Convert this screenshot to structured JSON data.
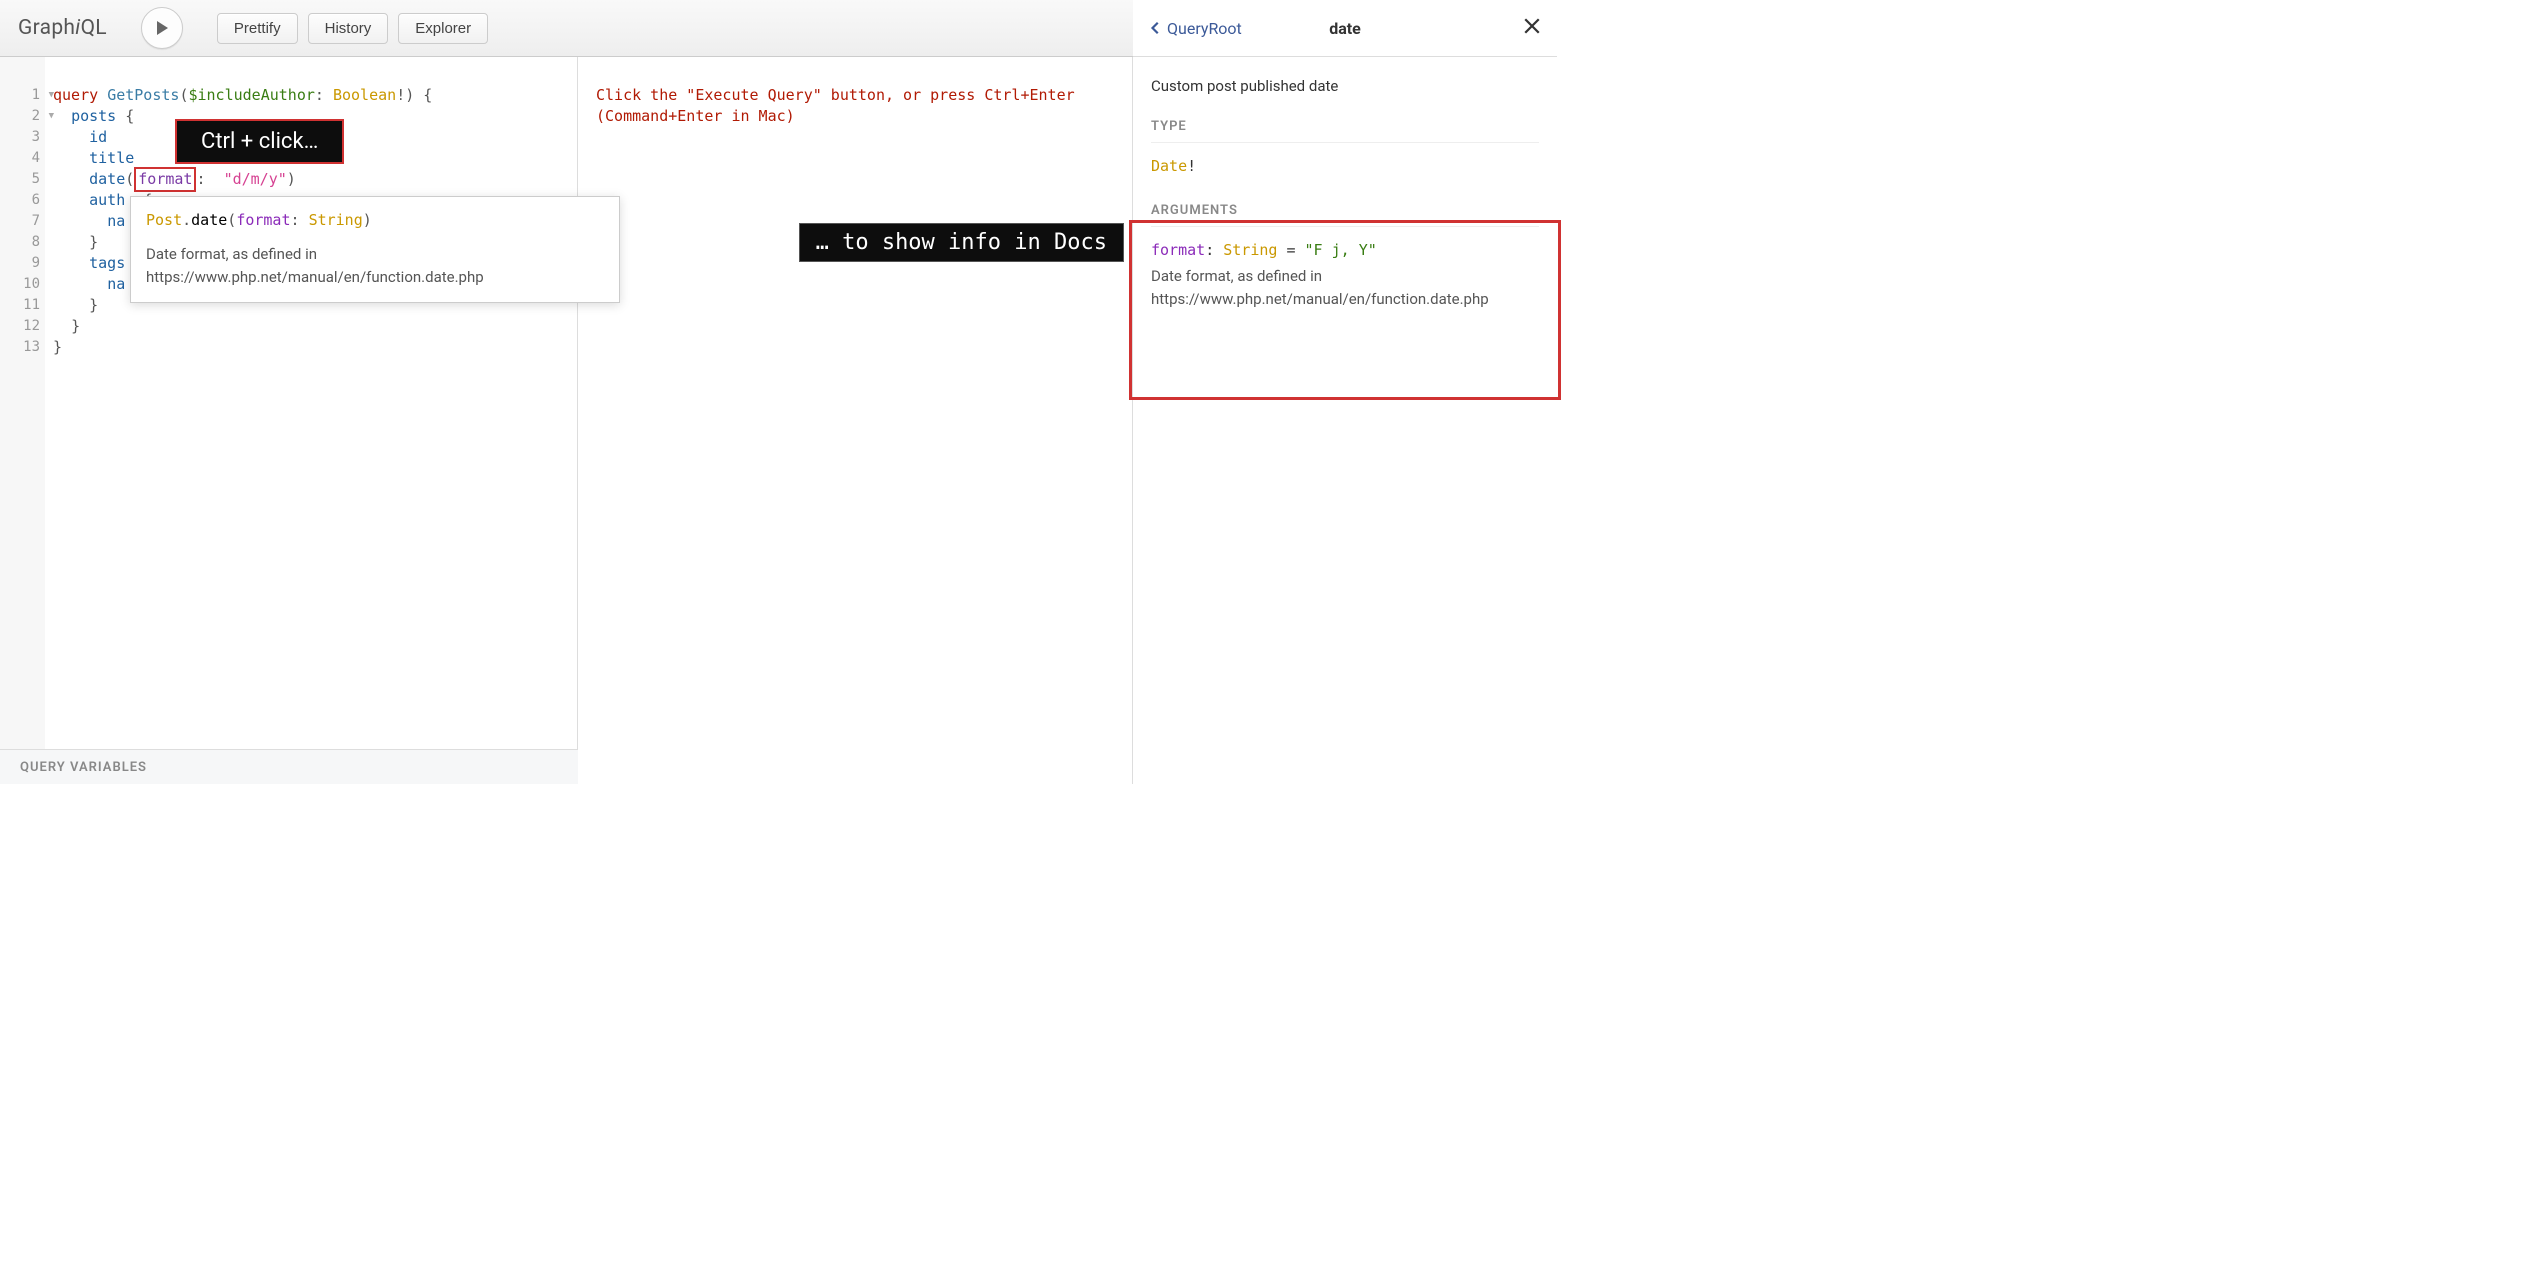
{
  "logo": {
    "prefix": "Graph",
    "ital": "i",
    "suffix": "QL"
  },
  "toolbar": {
    "prettify": "Prettify",
    "history": "History",
    "explorer": "Explorer"
  },
  "editor": {
    "lines": [
      "1",
      "2",
      "3",
      "4",
      "5",
      "6",
      "7",
      "8",
      "9",
      "10",
      "11",
      "12",
      "13"
    ]
  },
  "code": {
    "l1_kw": "query",
    "l1_def": "GetPosts",
    "l1_open": "(",
    "l1_var": "$includeAuthor",
    "l1_colon": ": ",
    "l1_type": "Boolean",
    "l1_bang": "!",
    "l1_close": ") {",
    "l2_field": "posts",
    "l2_brace": " {",
    "l3": "id",
    "l4": "title",
    "l5_field": "date",
    "l5_open": "(",
    "l5_arg": "format",
    "l5_colon": ": ",
    "l5_str": "\"d/m/y\"",
    "l5_close": ")",
    "l6_field": "auth",
    "l6_brace": "  {",
    "l7": "na",
    "l8": "}",
    "l9_field": "tags",
    "l10": "na",
    "l11": "}",
    "l12": "}",
    "l13": "}"
  },
  "annotation1": "Ctrl + click…",
  "tooltip": {
    "type": "Post",
    "dot": ".",
    "field": "date",
    "open": "(",
    "arg": "format",
    "argcolon": ": ",
    "argtype": "String",
    "close": ")",
    "desc": "Date format, as defined in https://www.php.net/manual/en/function.date.php"
  },
  "variables_label": "QUERY VARIABLES",
  "result": {
    "line1": "Click the \"Execute Query\" button, or press Ctrl+Enter",
    "line2": "(Command+Enter in Mac)"
  },
  "annotation2": "… to show info in Docs",
  "docs": {
    "back_label": "QueryRoot",
    "title": "date",
    "description": "Custom post published date",
    "type_label": "TYPE",
    "type_value": "Date",
    "type_bang": "!",
    "args_label": "ARGUMENTS",
    "arg_name": "format",
    "arg_colon": ": ",
    "arg_type": "String",
    "arg_eq": " = ",
    "arg_default": "\"F j, Y\"",
    "arg_desc": "Date format, as defined in https://www.php.net/manual/en/function.date.php"
  }
}
